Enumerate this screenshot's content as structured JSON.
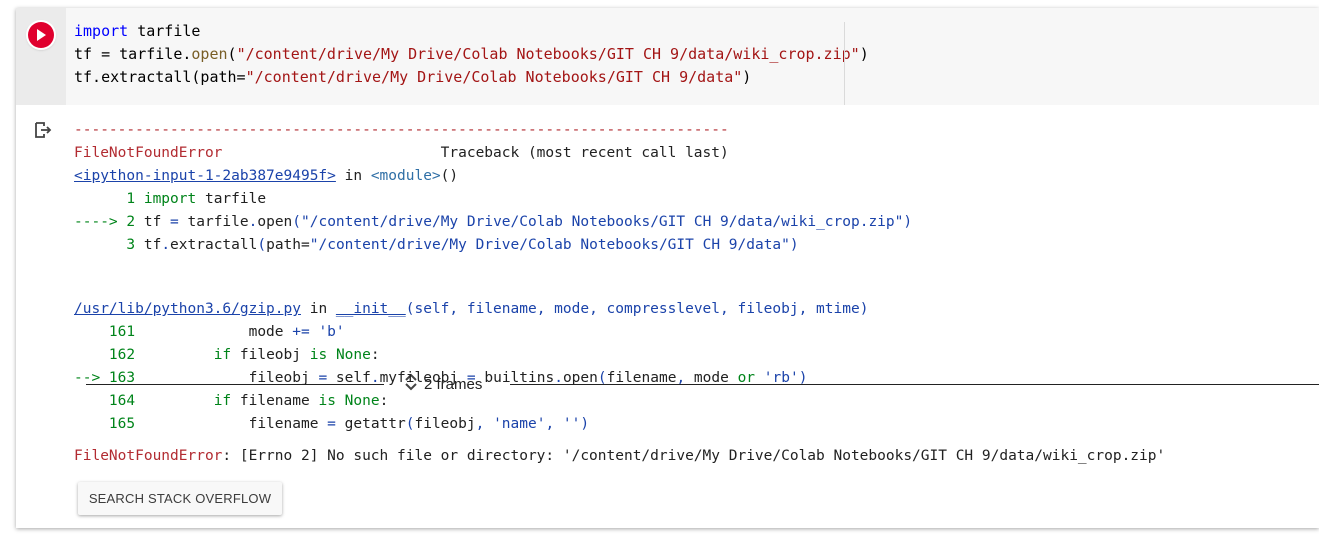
{
  "code_cell": {
    "lines": [
      [
        {
          "t": "import",
          "c": "kw"
        },
        {
          "t": " tarfile"
        }
      ],
      [
        {
          "t": "tf = tarfile."
        },
        {
          "t": "open",
          "c": "fn"
        },
        {
          "t": "("
        },
        {
          "t": "\"/content/drive/My Drive/Colab Notebooks/GIT CH 9/data/wiki_crop.zip\"",
          "c": "str"
        },
        {
          "t": ")"
        }
      ],
      [
        {
          "t": "tf.extractall(path="
        },
        {
          "t": "\"/content/drive/My Drive/Colab Notebooks/GIT CH 9/data\"",
          "c": "str"
        },
        {
          "t": ")"
        }
      ]
    ]
  },
  "output": {
    "lines": [
      [
        {
          "t": "---------------------------------------------------------------------------",
          "c": "err"
        }
      ],
      [
        {
          "t": "FileNotFoundError",
          "c": "err"
        },
        {
          "t": "                         Traceback (most recent call last)"
        }
      ],
      [
        {
          "t": "<ipython-input-1-2ab387e9495f>",
          "c": "link"
        },
        {
          "t": " in "
        },
        {
          "t": "<module>",
          "c": "cy"
        },
        {
          "t": "()"
        }
      ],
      [
        {
          "t": "      1 ",
          "c": "gl"
        },
        {
          "t": "import",
          "c": "gl"
        },
        {
          "t": " tarfile"
        }
      ],
      [
        {
          "t": "----> 2 ",
          "c": "gl"
        },
        {
          "t": "tf "
        },
        {
          "t": "=",
          "c": "bl"
        },
        {
          "t": " tarfile"
        },
        {
          "t": ".",
          "c": "bl"
        },
        {
          "t": "open"
        },
        {
          "t": "(",
          "c": "bl"
        },
        {
          "t": "\"/content/drive/My Drive/Colab Notebooks/GIT CH 9/data/wiki_crop.zip\"",
          "c": "bl"
        },
        {
          "t": ")",
          "c": "bl"
        }
      ],
      [
        {
          "t": "      3 ",
          "c": "gl"
        },
        {
          "t": "tf"
        },
        {
          "t": ".",
          "c": "bl"
        },
        {
          "t": "extractall"
        },
        {
          "t": "(",
          "c": "bl"
        },
        {
          "t": "path="
        },
        {
          "t": "\"/content/drive/My Drive/Colab Notebooks/GIT CH 9/data\"",
          "c": "bl"
        },
        {
          "t": ")",
          "c": "bl"
        }
      ]
    ],
    "frames_label": "2 frames",
    "frame_lines": [
      [
        {
          "t": "/usr/lib/python3.6/gzip.py",
          "c": "link"
        },
        {
          "t": " in "
        },
        {
          "t": "__init__",
          "c": "link"
        },
        {
          "t": "(self, filename, mode, compresslevel, fileobj, mtime)",
          "c": "bl"
        }
      ],
      [
        {
          "t": "    161 ",
          "c": "gl"
        },
        {
          "t": "            mode "
        },
        {
          "t": "+=",
          "c": "bl"
        },
        {
          "t": " "
        },
        {
          "t": "'b'",
          "c": "bl"
        }
      ],
      [
        {
          "t": "    162 ",
          "c": "gl"
        },
        {
          "t": "        "
        },
        {
          "t": "if",
          "c": "gl"
        },
        {
          "t": " fileobj "
        },
        {
          "t": "is",
          "c": "gl"
        },
        {
          "t": " "
        },
        {
          "t": "None",
          "c": "gl"
        },
        {
          "t": ":"
        }
      ],
      [
        {
          "t": "--> 163 ",
          "c": "gl"
        },
        {
          "t": "            fileobj "
        },
        {
          "t": "=",
          "c": "bl"
        },
        {
          "t": " self"
        },
        {
          "t": ".",
          "c": "bl"
        },
        {
          "t": "myfileobj "
        },
        {
          "t": "=",
          "c": "bl"
        },
        {
          "t": " builtins"
        },
        {
          "t": ".",
          "c": "bl"
        },
        {
          "t": "open"
        },
        {
          "t": "(",
          "c": "bl"
        },
        {
          "t": "filename"
        },
        {
          "t": ",",
          "c": "bl"
        },
        {
          "t": " mode "
        },
        {
          "t": "or",
          "c": "gl"
        },
        {
          "t": " "
        },
        {
          "t": "'rb'",
          "c": "bl"
        },
        {
          "t": ")",
          "c": "bl"
        }
      ],
      [
        {
          "t": "    164 ",
          "c": "gl"
        },
        {
          "t": "        "
        },
        {
          "t": "if",
          "c": "gl"
        },
        {
          "t": " filename "
        },
        {
          "t": "is",
          "c": "gl"
        },
        {
          "t": " "
        },
        {
          "t": "None",
          "c": "gl"
        },
        {
          "t": ":"
        }
      ],
      [
        {
          "t": "    165 ",
          "c": "gl"
        },
        {
          "t": "            filename "
        },
        {
          "t": "=",
          "c": "bl"
        },
        {
          "t": " getattr"
        },
        {
          "t": "(",
          "c": "bl"
        },
        {
          "t": "fileobj"
        },
        {
          "t": ",",
          "c": "bl"
        },
        {
          "t": " "
        },
        {
          "t": "'name'",
          "c": "bl"
        },
        {
          "t": ",",
          "c": "bl"
        },
        {
          "t": " "
        },
        {
          "t": "''",
          "c": "bl"
        },
        {
          "t": ")",
          "c": "bl"
        }
      ]
    ],
    "error_lines": [
      [
        {
          "t": "FileNotFoundError",
          "c": "err"
        },
        {
          "t": ": [Errno 2] No such file or directory: '/content/drive/My Drive/Colab Notebooks/GIT CH 9/data/wiki_crop.zip'"
        }
      ]
    ],
    "search_button_label": "SEARCH STACK OVERFLOW"
  },
  "colors": {
    "run_button": "#e0002e",
    "error_red": "#b22b31",
    "keyword_green": "#00841a",
    "link_blue": "#1b43aa"
  },
  "icons": {
    "run": "play-circle-icon",
    "output": "output-redirect-icon",
    "frames": "unfold-more-icon"
  }
}
